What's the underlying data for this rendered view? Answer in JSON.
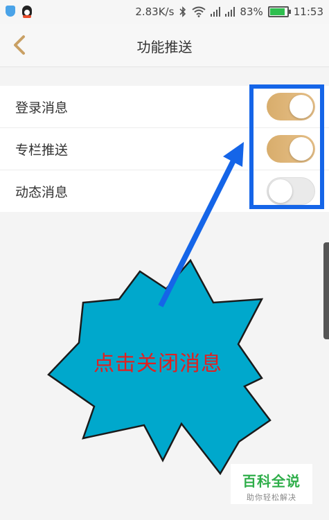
{
  "status_bar": {
    "network_speed": "2.83K/s",
    "battery_percent": "83%",
    "time": "11:53",
    "icons": [
      "shield-icon",
      "qq-penguin-icon",
      "bluetooth-icon",
      "wifi-icon",
      "signal-icon",
      "signal-icon",
      "battery-icon"
    ],
    "battery_level": 0.83
  },
  "header": {
    "title": "功能推送",
    "back_icon": "chevron-left-icon",
    "back_color": "#c9a064"
  },
  "settings": [
    {
      "label": "登录消息",
      "enabled": true
    },
    {
      "label": "专栏推送",
      "enabled": true
    },
    {
      "label": "动态消息",
      "enabled": false
    }
  ],
  "annotation": {
    "callout_text": "点击关闭消息",
    "callout_color": "#00a8cc",
    "box_color": "#1565e8",
    "text_color": "#e02020"
  },
  "watermark": {
    "title": "百科全说",
    "subtitle": "助你轻松解决"
  }
}
